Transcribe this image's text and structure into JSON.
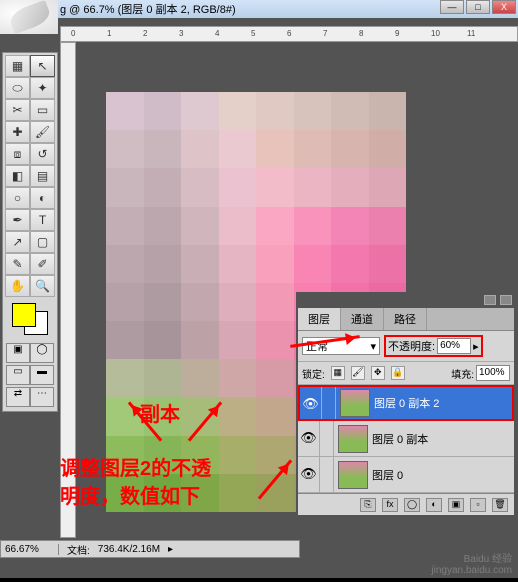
{
  "title_suffix": "g @ 66.7% (图层 0 副本 2, RGB/8#)",
  "ruler_marks": [
    "0",
    "1",
    "2",
    "3",
    "4",
    "5",
    "6",
    "7",
    "8",
    "9",
    "10",
    "11"
  ],
  "window_buttons": {
    "min": "—",
    "max": "□",
    "close": "X"
  },
  "layers_panel": {
    "tabs": [
      "图层",
      "通道",
      "路径"
    ],
    "blend_mode": "正常",
    "opacity_label": "不透明度:",
    "opacity_value": "60%",
    "lock_label": "锁定:",
    "fill_label": "填充:",
    "fill_value": "100%",
    "layers": [
      {
        "name": "图层 0 副本 2",
        "selected": true
      },
      {
        "name": "图层 0 副本",
        "selected": false
      },
      {
        "name": "图层 0",
        "selected": false
      }
    ]
  },
  "status": {
    "zoom": "66.67%",
    "doc_label": "文档:",
    "doc_size": "736.4K/2.16M"
  },
  "annotations": {
    "fuben": "副本",
    "line1": "调整图层2的不透",
    "line2": "明度，数值如下"
  },
  "watermark": {
    "brand": "Baidu 经验",
    "url": "jingyan.baidu.com"
  },
  "mosaic_colors": [
    "#d4b8c8",
    "#c8b0c0",
    "#d8c0c8",
    "#e0c8c0",
    "#dcc0b8",
    "#d0b8b0",
    "#c8b0a8",
    "#c0a8a0",
    "#c8b0b8",
    "#c0a8b0",
    "#d8b8c0",
    "#e8c0c8",
    "#e4b8b0",
    "#d8b0a8",
    "#d0a8a0",
    "#c8a098",
    "#c0a8b0",
    "#b8a0a8",
    "#d0b0b8",
    "#e8b8c8",
    "#f0b0c0",
    "#e8a8b8",
    "#e0a0b0",
    "#d898a8",
    "#b8a0a8",
    "#b098a0",
    "#c8a8b0",
    "#e8b0c0",
    "#f898b8",
    "#f880b0",
    "#f070a8",
    "#e868a0",
    "#b098a0",
    "#a89098",
    "#c0a0a8",
    "#e0a8b8",
    "#f890b0",
    "#f870a8",
    "#f060a0",
    "#e85898",
    "#a89098",
    "#a08890",
    "#b898a0",
    "#d8a0b0",
    "#f088a8",
    "#f868a0",
    "#f05898",
    "#e85090",
    "#a08890",
    "#988088",
    "#b09098",
    "#d098a8",
    "#e880a0",
    "#f06098",
    "#e85090",
    "#e04888",
    "#a8b088",
    "#a0a880",
    "#b0a088",
    "#c89898",
    "#d08898",
    "#d07890",
    "#c87088",
    "#c06880",
    "#90c060",
    "#88b858",
    "#98b060",
    "#b0a070",
    "#b89878",
    "#b89080",
    "#b08878",
    "#a88070",
    "#78b040",
    "#70a838",
    "#80a840",
    "#98a050",
    "#a09858",
    "#a09060",
    "#988858",
    "#908050",
    "#60a028",
    "#589820",
    "#689828",
    "#809838",
    "#889040",
    "#888848",
    "#808040",
    "#787838"
  ]
}
